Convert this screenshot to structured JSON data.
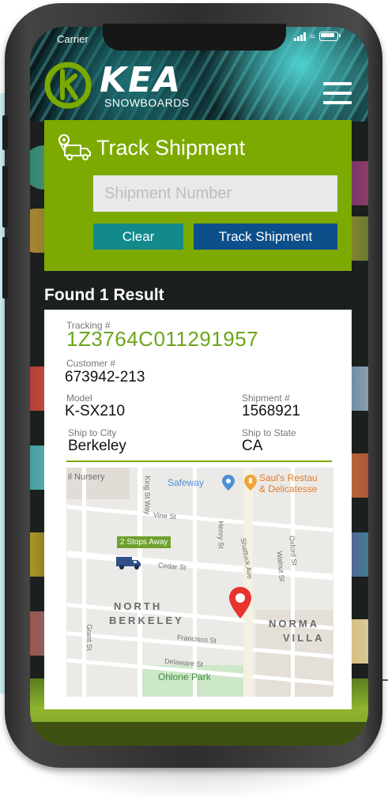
{
  "status_bar": {
    "carrier": "Carrier"
  },
  "brand": {
    "name": "KEA",
    "tagline": "SNOWBOARDS"
  },
  "track": {
    "title": "Track Shipment",
    "input_placeholder": "Shipment Number",
    "input_value": "",
    "clear_label": "Clear",
    "submit_label": "Track Shipment"
  },
  "results": {
    "summary": "Found 1 Result",
    "item": {
      "tracking_label": "Tracking #",
      "tracking_value": "1Z3764C011291957",
      "customer_label": "Customer #",
      "customer_value": "673942-213",
      "model_label": "Model",
      "model_value": "K-SX210",
      "shipment_label": "Shipment #",
      "shipment_value": "1568921",
      "city_label": "Ship to City",
      "city_value": "Berkeley",
      "state_label": "Ship to State",
      "state_value": "CA"
    }
  },
  "map": {
    "stops_badge": "2 Stops Away",
    "poi_safeway": "Safeway",
    "poi_sauls_line1": "Saul's Restau",
    "poi_sauls_line2": "& Delicatesse",
    "poi_nursery": "il Nursery",
    "place_north": "NORTH",
    "place_berkeley": "BERKELEY",
    "place_norma": "NORMA",
    "place_villa": "VILLA",
    "park": "Ohlone Park",
    "street_king": "King St Way",
    "street_vine": "Vine St",
    "street_henry": "Henry St",
    "street_shattuck": "Shattuck Ave",
    "street_oxford": "Oxford St",
    "street_walnut": "Walnut St",
    "street_cedar": "Cedar St",
    "street_francisco": "Francisco St",
    "street_delaware": "Delaware St",
    "street_grant": "Grant St"
  },
  "colors": {
    "brand_green": "#7caa00",
    "tracking_green": "#6aa61a",
    "clear_teal": "#128a8c",
    "track_blue": "#0d4f8a",
    "pin_red": "#e8332f"
  },
  "icons": {
    "menu": "hamburger-icon",
    "track": "truck-location-icon",
    "vehicle": "truck-icon",
    "destination": "map-pin-icon"
  }
}
